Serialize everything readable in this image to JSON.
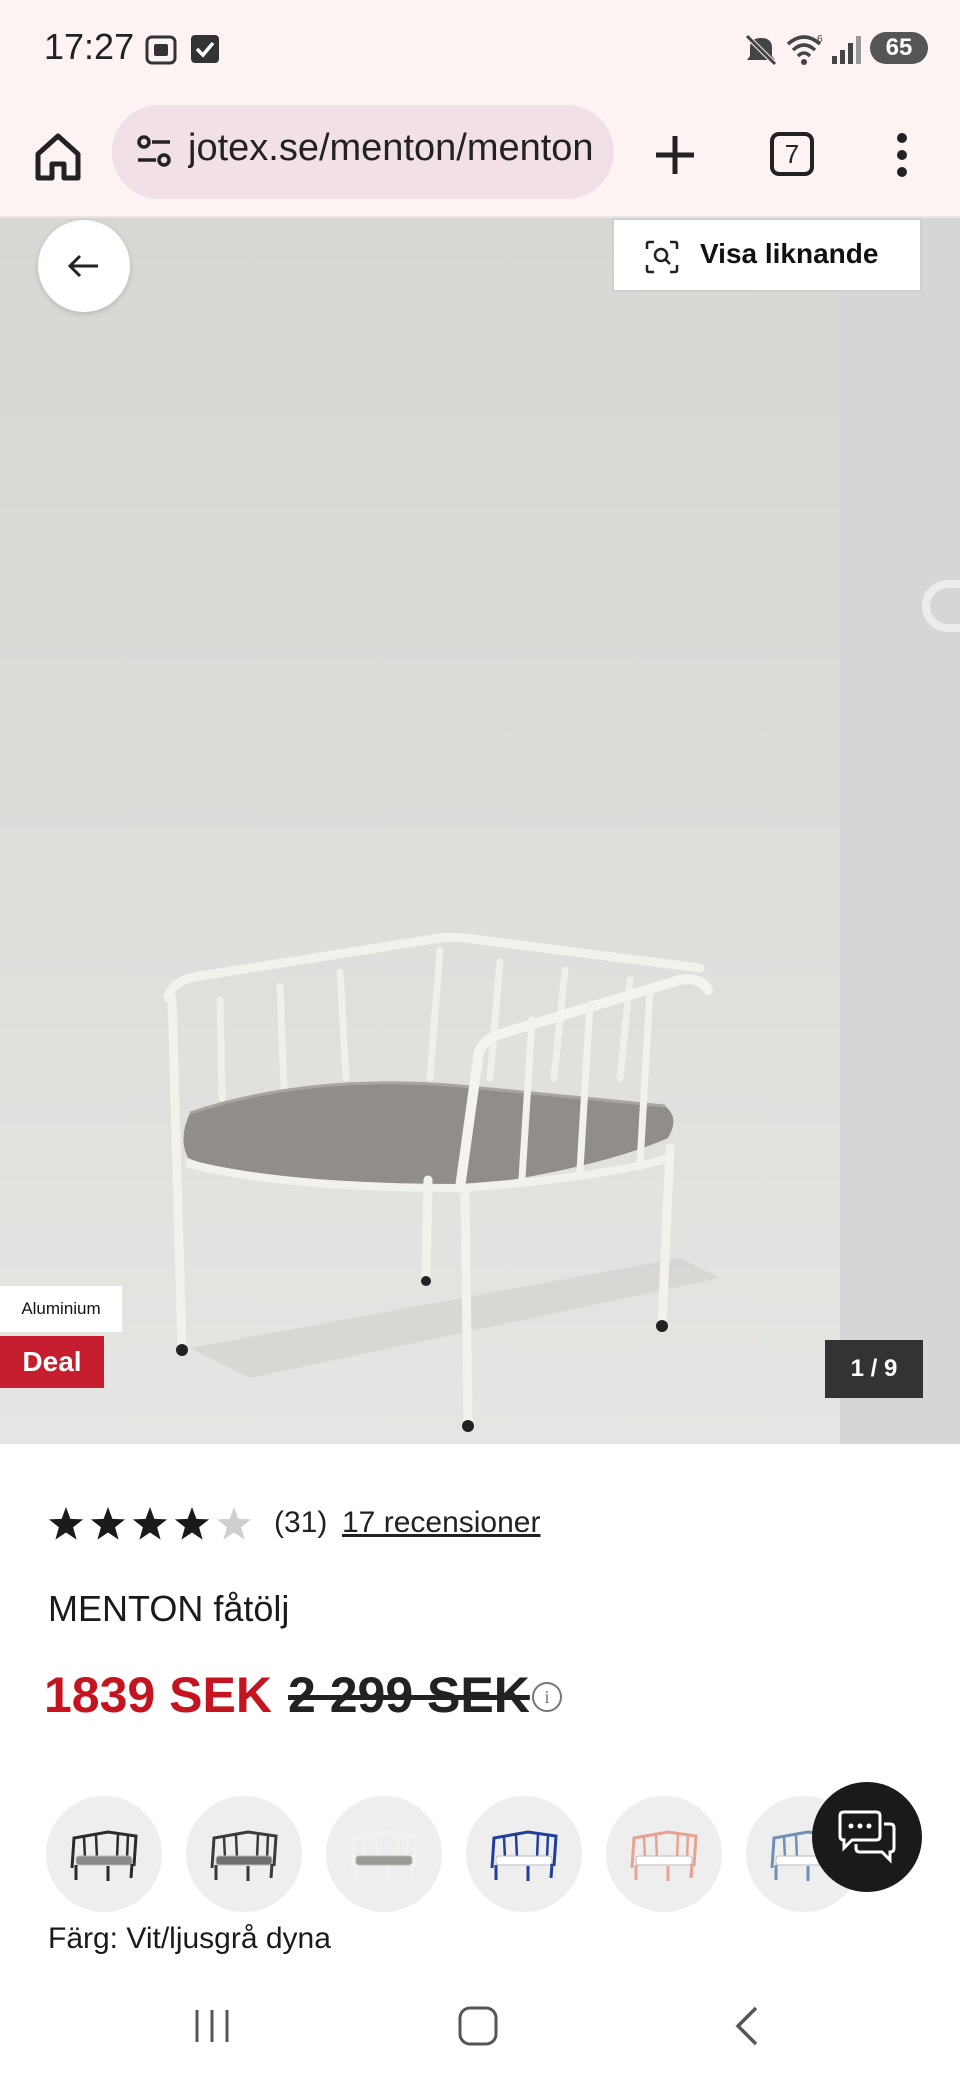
{
  "status_bar": {
    "time": "17:27",
    "battery": "65",
    "icons": [
      "screenshot-icon",
      "checkbox-icon",
      "mute-icon",
      "wifi-icon",
      "signal-icon"
    ]
  },
  "browser": {
    "url": "jotex.se/menton/menton",
    "tab_count": "7",
    "icons": [
      "home-icon",
      "site-settings-icon",
      "new-tab-icon",
      "tab-switcher-icon",
      "more-menu-icon"
    ]
  },
  "gallery": {
    "visual_search_label": "Visa liknande",
    "material_tag": "Aluminium",
    "deal_tag": "Deal",
    "counter": "1 / 9"
  },
  "product": {
    "rating_value": 4,
    "rating_max": 5,
    "rating_count": "(31)",
    "reviews_link": "17 recensioner",
    "title": "MENTON fåtölj",
    "price_now": "1839 SEK",
    "price_old": "2 299 SEK",
    "color_label": "Färg: Vit/ljusgrå dyna",
    "swatches": [
      {
        "frame": "#2b2b2b",
        "cushion": "#8a8a8a"
      },
      {
        "frame": "#3a3a3a",
        "cushion": "#6f6f6f"
      },
      {
        "frame": "#f2f2ee",
        "cushion": "#9c9a96"
      },
      {
        "frame": "#1f3f9c",
        "cushion": "#ffffff"
      },
      {
        "frame": "#e8a28f",
        "cushion": "#ffffff"
      },
      {
        "frame": "#6f8fb5",
        "cushion": "#ffffff"
      }
    ]
  },
  "colors": {
    "accent_red": "#c4141f",
    "deal_red": "#c61e2e",
    "browser_bg": "#fdf3f3"
  }
}
